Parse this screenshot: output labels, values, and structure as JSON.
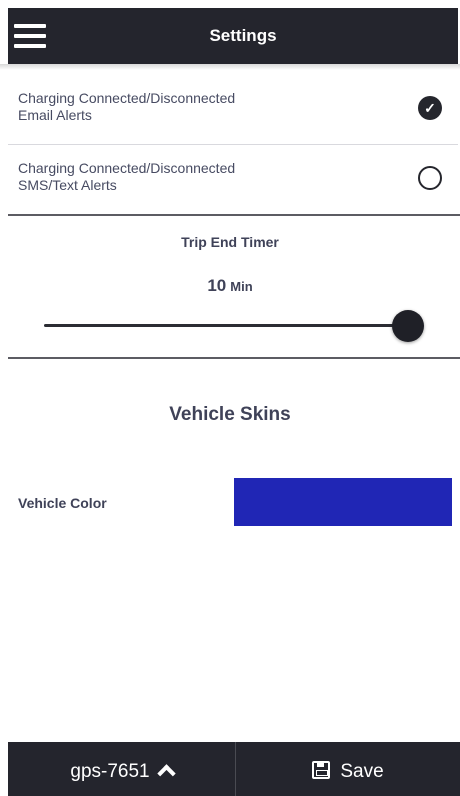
{
  "header": {
    "title": "Settings",
    "menu_icon": "hamburger-menu-icon"
  },
  "alerts": {
    "email": {
      "label_line1": "Charging Connected/Disconnected",
      "label_line2": "Email Alerts",
      "checked": true
    },
    "sms": {
      "label_line1": "Charging Connected/Disconnected",
      "label_line2": "SMS/Text Alerts",
      "checked": false
    }
  },
  "timer": {
    "title": "Trip End Timer",
    "value": "10",
    "unit": "Min",
    "slider_level": 1.0
  },
  "skins": {
    "title": "Vehicle Skins",
    "color_label": "Vehicle Color",
    "color": "#2026b5"
  },
  "bottom_bar": {
    "device_label": "gps-7651",
    "save_label": "Save",
    "device_icon": "chevron-up-icon",
    "save_icon": "floppy-disk-icon"
  },
  "colors": {
    "header_bg": "#24252d",
    "text": "#3f4258"
  }
}
